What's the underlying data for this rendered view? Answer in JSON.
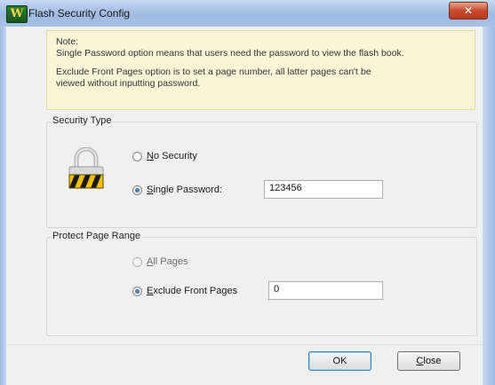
{
  "window": {
    "title": "Flash Security Config",
    "app_icon_glyph": "W",
    "close_glyph": "✕"
  },
  "note": {
    "heading": "Note:",
    "line1": "Single Password option means that users need the password to view the flash book.",
    "line2": "Exclude Front Pages option is to set a page number, all latter pages can't be",
    "line3": "viewed without inputting password."
  },
  "security_type": {
    "label": "Security Type",
    "no_security": {
      "hotkey": "N",
      "rest": "o Security",
      "selected": false
    },
    "single_password": {
      "hotkey": "S",
      "rest": "ingle Password:",
      "selected": true,
      "value": "123456"
    }
  },
  "page_range": {
    "label": "Protect Page Range",
    "all_pages": {
      "hotkey": "A",
      "rest": "ll Pages",
      "selected": false
    },
    "exclude_front": {
      "hotkey": "E",
      "rest": "xclude Front Pages",
      "selected": true,
      "value": "0"
    }
  },
  "buttons": {
    "ok": "OK",
    "close_hotkey": "C",
    "close_rest": "lose"
  },
  "colors": {
    "note_bg": "#fbf5d8",
    "dialog_bg": "#f0f0f0",
    "titlebar": "#a9c2e6",
    "close_button": "#c94b2f"
  },
  "icons": [
    "app-logo-icon",
    "close-icon",
    "padlock-icon"
  ]
}
